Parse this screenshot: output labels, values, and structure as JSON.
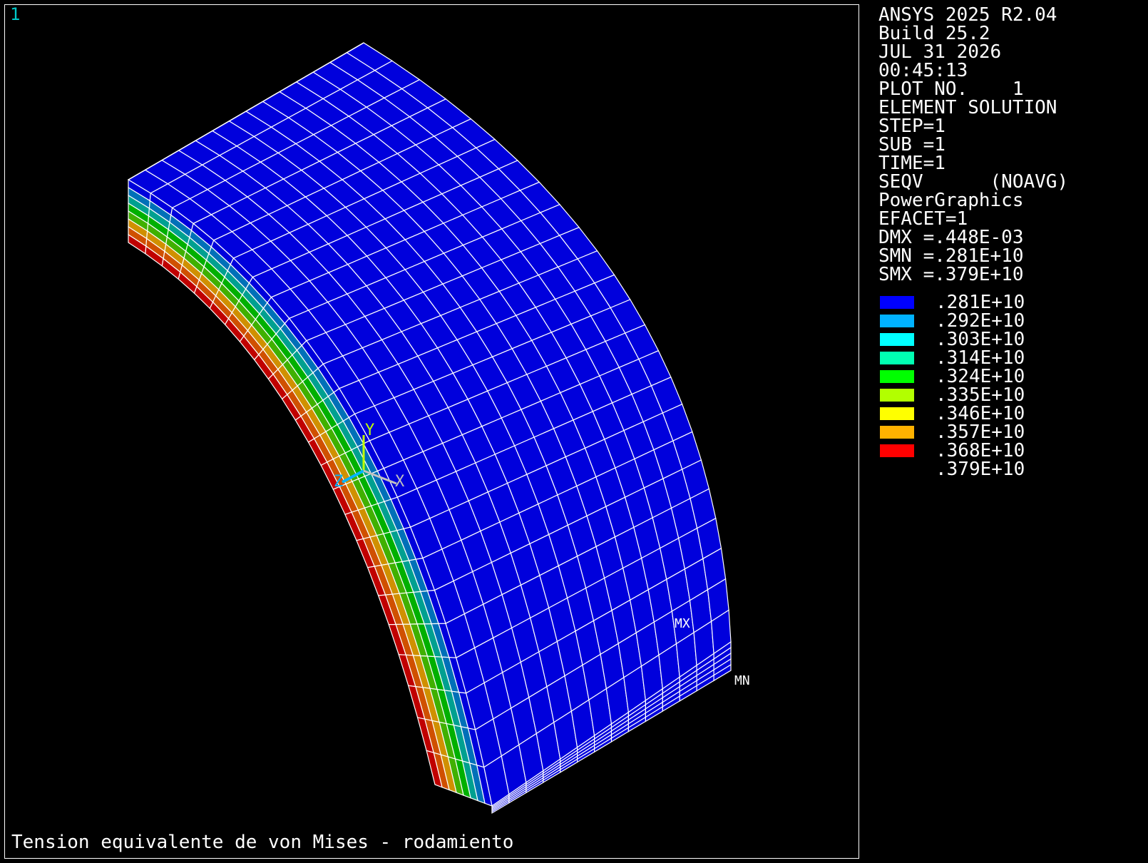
{
  "window_number": "1",
  "plot_title": "Tension equivalente de von Mises - rodamiento",
  "info_lines": [
    "ANSYS 2025 R2.04",
    "Build 25.2",
    "JUL 31 2026",
    "00:45:13",
    "PLOT NO.    1",
    "ELEMENT SOLUTION",
    "STEP=1",
    "SUB =1",
    "TIME=1",
    "SEQV      (NOAVG)",
    "PowerGraphics",
    "EFACET=1",
    "DMX =.448E-03",
    "SMN =.281E+10",
    "SMX =.379E+10"
  ],
  "legend": [
    {
      "value": ".281E+10",
      "color": "#0000ff"
    },
    {
      "value": ".292E+10",
      "color": "#00b2ff"
    },
    {
      "value": ".303E+10",
      "color": "#00ffff"
    },
    {
      "value": ".314E+10",
      "color": "#00ffb2"
    },
    {
      "value": ".324E+10",
      "color": "#00ff00"
    },
    {
      "value": ".335E+10",
      "color": "#b2ff00"
    },
    {
      "value": ".346E+10",
      "color": "#ffff00"
    },
    {
      "value": ".357E+10",
      "color": "#ffb200"
    },
    {
      "value": ".368E+10",
      "color": "#ff0000"
    },
    {
      "value": ".379E+10",
      "color": ""
    }
  ],
  "markers": {
    "max": "MX",
    "min": "MN"
  },
  "triad": {
    "y": "Y",
    "z": "Z",
    "x": "X"
  },
  "colors": {
    "window_number": "#00c8c8",
    "mesh_fill": "#0000dc",
    "mesh_lines": "#ffffff",
    "band_colors": [
      "#0000dc",
      "#0070b8",
      "#00a090",
      "#00b000",
      "#40b000",
      "#d09000",
      "#d05000",
      "#c00000"
    ]
  }
}
